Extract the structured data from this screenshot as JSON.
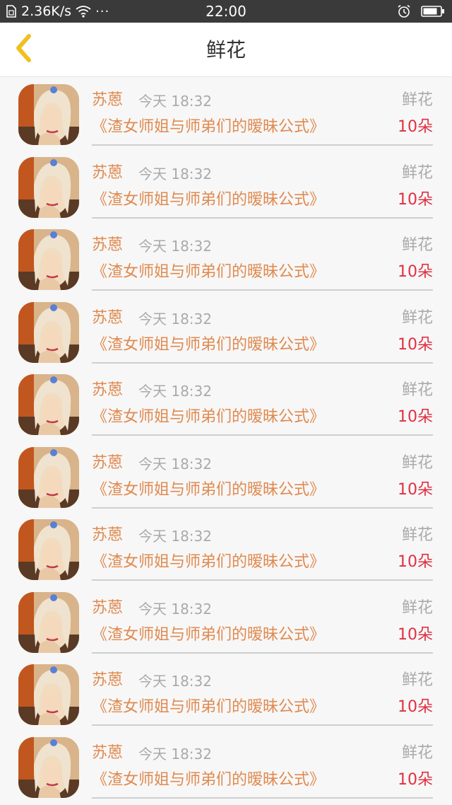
{
  "status_bar": {
    "speed": "2.36K/s",
    "dots": "···",
    "time": "22:00",
    "icons": [
      "sim-icon",
      "wifi-icon",
      "alarm-icon",
      "battery-icon"
    ]
  },
  "header": {
    "title": "鲜花",
    "back_icon": "chevron-left-icon",
    "accent_color": "#f0c020"
  },
  "colors": {
    "name": "#e08a4f",
    "book": "#e08a4f",
    "count": "#e03040",
    "muted": "#aaaaaa"
  },
  "list": {
    "items": [
      {
        "name": "苏蒽",
        "time": "今天 18:32",
        "gift": "鲜花",
        "book": "《渣女师姐与师弟们的暧昧公式》",
        "count": "10朵"
      },
      {
        "name": "苏蒽",
        "time": "今天 18:32",
        "gift": "鲜花",
        "book": "《渣女师姐与师弟们的暧昧公式》",
        "count": "10朵"
      },
      {
        "name": "苏蒽",
        "time": "今天 18:32",
        "gift": "鲜花",
        "book": "《渣女师姐与师弟们的暧昧公式》",
        "count": "10朵"
      },
      {
        "name": "苏蒽",
        "time": "今天 18:32",
        "gift": "鲜花",
        "book": "《渣女师姐与师弟们的暧昧公式》",
        "count": "10朵"
      },
      {
        "name": "苏蒽",
        "time": "今天 18:32",
        "gift": "鲜花",
        "book": "《渣女师姐与师弟们的暧昧公式》",
        "count": "10朵"
      },
      {
        "name": "苏蒽",
        "time": "今天 18:32",
        "gift": "鲜花",
        "book": "《渣女师姐与师弟们的暧昧公式》",
        "count": "10朵"
      },
      {
        "name": "苏蒽",
        "time": "今天 18:32",
        "gift": "鲜花",
        "book": "《渣女师姐与师弟们的暧昧公式》",
        "count": "10朵"
      },
      {
        "name": "苏蒽",
        "time": "今天 18:32",
        "gift": "鲜花",
        "book": "《渣女师姐与师弟们的暧昧公式》",
        "count": "10朵"
      },
      {
        "name": "苏蒽",
        "time": "今天 18:32",
        "gift": "鲜花",
        "book": "《渣女师姐与师弟们的暧昧公式》",
        "count": "10朵"
      },
      {
        "name": "苏蒽",
        "time": "今天 18:32",
        "gift": "鲜花",
        "book": "《渣女师姐与师弟们的暧昧公式》",
        "count": "10朵"
      }
    ]
  }
}
